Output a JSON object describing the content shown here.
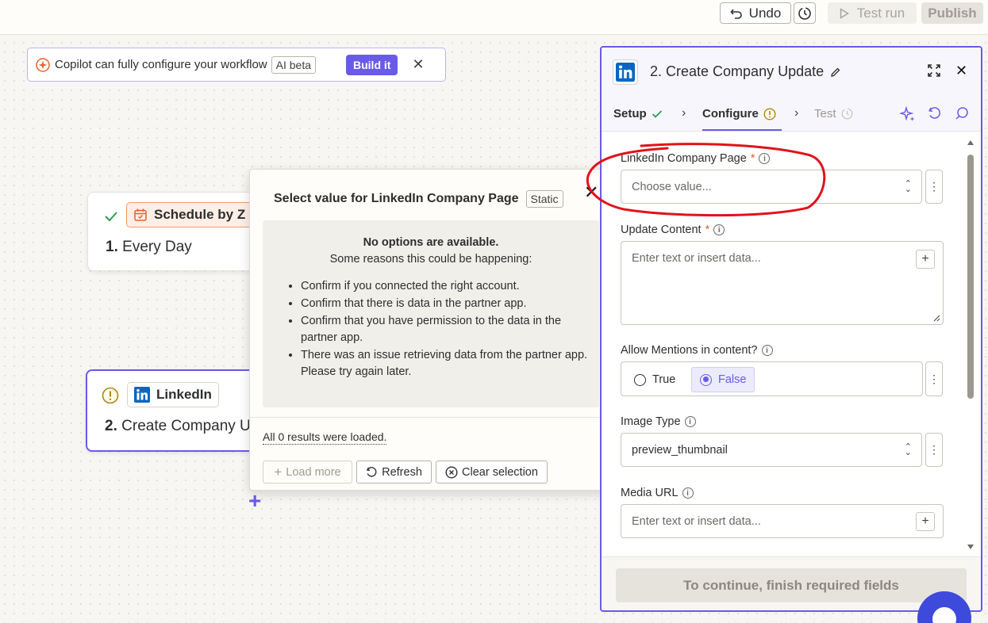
{
  "topbar": {
    "undo_label": "Undo",
    "test_run_label": "Test run",
    "publish_label": "Publish"
  },
  "copilot": {
    "message": "Copilot can fully configure your workflow",
    "badge": "AI beta",
    "build_label": "Build it"
  },
  "canvas": {
    "step1": {
      "app": "Schedule by Z",
      "number": "1.",
      "title": "Every Day"
    },
    "step2": {
      "app": "LinkedIn",
      "number": "2.",
      "title": "Create Company U"
    }
  },
  "popover": {
    "title": "Select value for LinkedIn Company Page",
    "badge": "Static",
    "empty_title": "No options are available.",
    "empty_subtitle": "Some reasons this could be happening:",
    "reasons": [
      "Confirm if you connected the right account.",
      "Confirm that there is data in the partner app.",
      "Confirm that you have permission to the data in the partner app.",
      "There was an issue retrieving data from the partner app. Please try again later."
    ],
    "results_text": "All 0 results were loaded.",
    "load_more_label": "Load more",
    "refresh_label": "Refresh",
    "clear_label": "Clear selection"
  },
  "panel": {
    "title": "2. Create Company Update",
    "tabs": {
      "setup": "Setup",
      "configure": "Configure",
      "test": "Test"
    },
    "fields": {
      "company_page": {
        "label": "LinkedIn Company Page",
        "placeholder": "Choose value..."
      },
      "update_content": {
        "label": "Update Content",
        "placeholder": "Enter text or insert data..."
      },
      "allow_mentions": {
        "label": "Allow Mentions in content?",
        "true_label": "True",
        "false_label": "False",
        "selected": "False"
      },
      "image_type": {
        "label": "Image Type",
        "value": "preview_thumbnail"
      },
      "media_url": {
        "label": "Media URL",
        "placeholder": "Enter text or insert data..."
      }
    },
    "continue_label": "To continue, finish required fields"
  },
  "colors": {
    "accent": "#695be8",
    "warning": "#c49a1a",
    "success": "#2e9e4f",
    "annotation": "#e0131c",
    "linkedin": "#0a66c2"
  }
}
